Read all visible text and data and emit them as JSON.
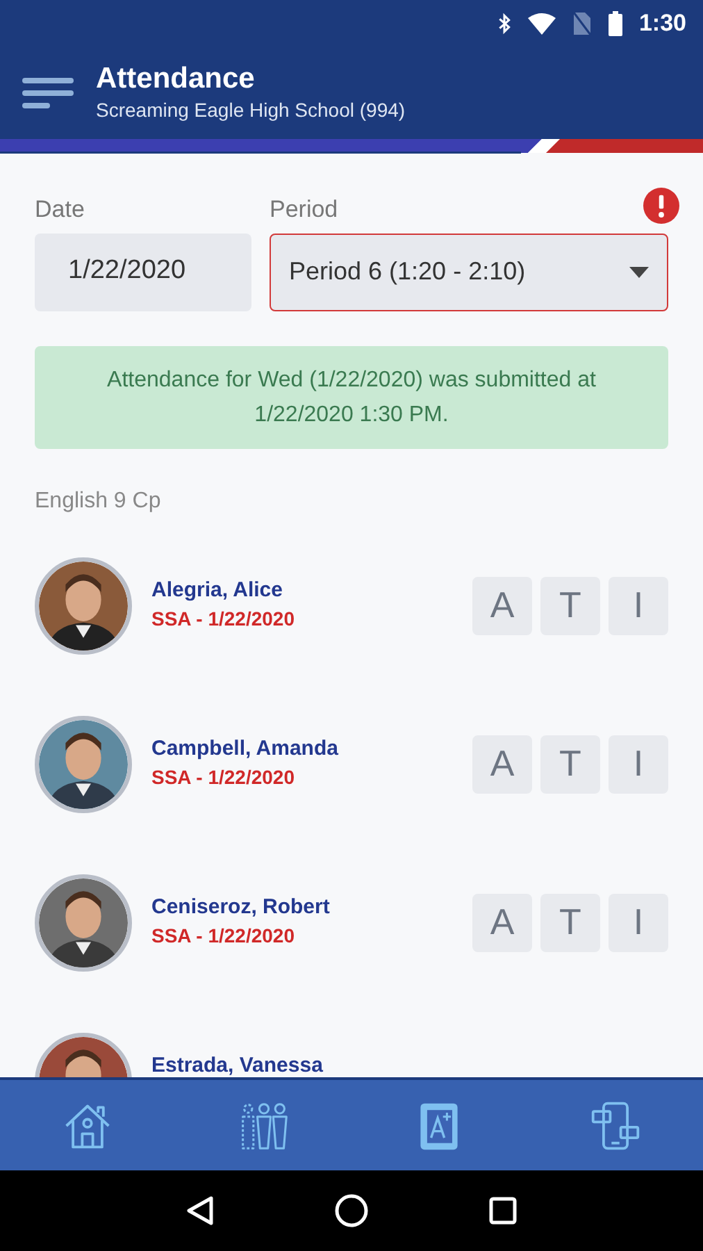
{
  "status_bar": {
    "time": "1:30"
  },
  "header": {
    "title": "Attendance",
    "subtitle": "Screaming Eagle High School (994)"
  },
  "filters": {
    "date": {
      "label": "Date",
      "value": "1/22/2020"
    },
    "period": {
      "label": "Period",
      "value": "Period 6 (1:20 - 2:10)",
      "error": true
    }
  },
  "banner": {
    "message": "Attendance for Wed (1/22/2020) was submitted at 1/22/2020 1:30 PM."
  },
  "class_name": "English 9 Cp",
  "students": [
    {
      "name": "Alegria, Alice",
      "note": "SSA - 1/22/2020",
      "photo": {
        "kind": "picture"
      },
      "buttons": [
        "A",
        "T",
        "I"
      ]
    },
    {
      "name": "Campbell, Amanda",
      "note": "SSA - 1/22/2020",
      "photo": {
        "kind": "picture"
      },
      "buttons": [
        "A",
        "T",
        "I"
      ]
    },
    {
      "name": "Ceniseroz, Robert",
      "note": "SSA - 1/22/2020",
      "photo": {
        "kind": "picture"
      },
      "buttons": [
        "A",
        "T",
        "I"
      ]
    },
    {
      "name": "Estrada, Vanessa",
      "photo": {
        "kind": "picture"
      }
    }
  ],
  "bottom_nav": [
    {
      "kind": "home"
    },
    {
      "kind": "students"
    },
    {
      "kind": "gradebook"
    },
    {
      "kind": "messages"
    }
  ]
}
